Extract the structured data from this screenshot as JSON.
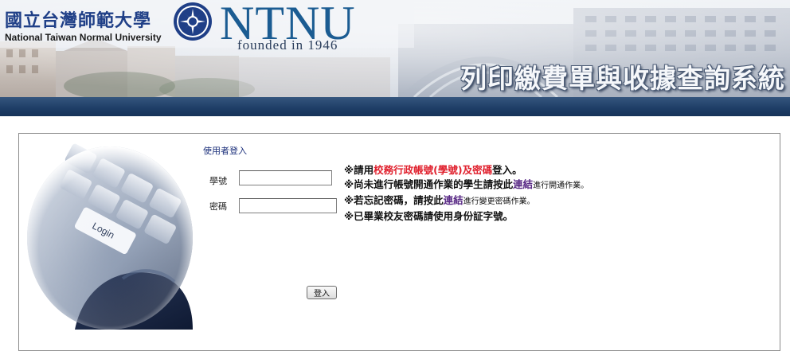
{
  "header": {
    "university_zh": "國立台灣師範大學",
    "university_en": "National Taiwan Normal University",
    "logo_text": "NTNU",
    "founded": "founded in 1946",
    "system_title": "列印繳費單與收據查詢系統"
  },
  "login": {
    "title": "使用者登入",
    "student_id_label": "學號",
    "password_label": "密碼",
    "student_id_value": "",
    "password_value": "",
    "submit_label": "登入"
  },
  "notes": [
    {
      "prefix": "※請用",
      "highlight": "校務行政帳號(學號)及密碼",
      "suffix": "登入。"
    },
    {
      "prefix": "※尚未進行帳號開通作業的學生請按此",
      "link": "連結",
      "suffix": "進行開通作業。"
    },
    {
      "prefix": "※若忘記密碼，請按此",
      "link": "連結",
      "suffix": "進行變更密碼作業。"
    },
    {
      "text": "※已畢業校友密碼請使用身份証字號。"
    }
  ],
  "colors": {
    "accent_blue": "#1e3d66",
    "highlight_red": "#e0202d",
    "link_purple": "#5a2b86"
  },
  "icons": {
    "seal": "university-seal-icon",
    "photo": "keyboard-login-key-image"
  }
}
